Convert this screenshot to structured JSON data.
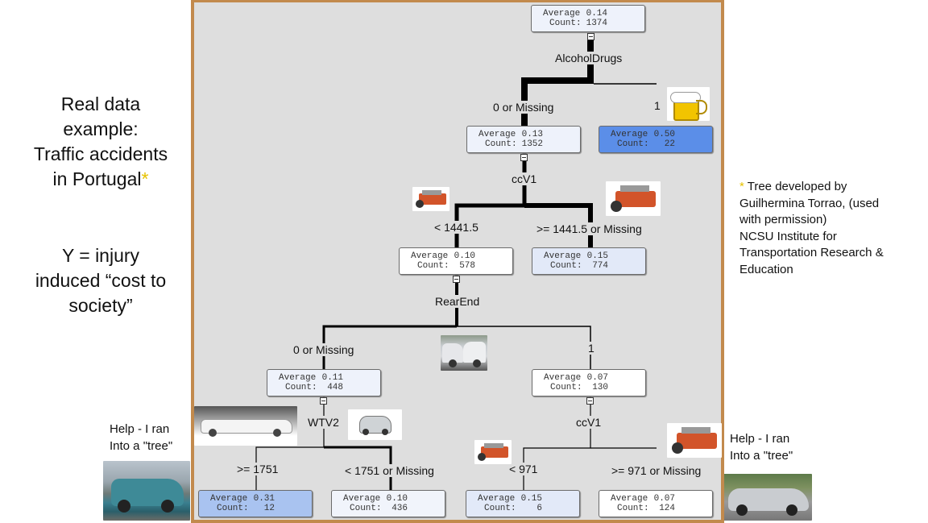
{
  "left_panel": {
    "title_lines": [
      "Real data",
      "example:",
      "Traffic accidents",
      "in Portugal"
    ],
    "title_marker": "*",
    "y_lines": [
      "Y = injury",
      "induced “cost to",
      "society”"
    ]
  },
  "credit": {
    "marker": "*",
    "lines": [
      " Tree developed by",
      "Guilhermina Torrao, (used",
      "with permission)",
      "NCSU  Institute for",
      "Transportation Research &",
      "Education"
    ]
  },
  "help_left": {
    "lines": [
      "Help - I ran",
      "Into  a \"tree\""
    ],
    "image": "wrecked-teal-car-photo"
  },
  "help_right": {
    "lines": [
      "Help - I ran",
      "Into  a \"tree\""
    ],
    "image": "wrecked-silver-car-photo"
  },
  "tree": {
    "colors": {
      "frame": "#c28a4d",
      "background": "#dedede",
      "light_node": "#eef2fb",
      "white_node": "#ffffff",
      "mid_node": "#c9d8f5",
      "strong_node": "#5b8ee8",
      "node_031": "#a9c3f0"
    },
    "node_labels": {
      "avg": "Average",
      "count": "Count:"
    },
    "nodes": [
      {
        "id": "root",
        "average": "0.14",
        "count": "1374"
      },
      {
        "id": "alc-0",
        "average": "0.13",
        "count": "1352"
      },
      {
        "id": "alc-1",
        "average": "0.50",
        "count": "22"
      },
      {
        "id": "cc-lt",
        "average": "0.10",
        "count": "578"
      },
      {
        "id": "cc-ge",
        "average": "0.15",
        "count": "774"
      },
      {
        "id": "rear-0",
        "average": "0.11",
        "count": "448"
      },
      {
        "id": "rear-1",
        "average": "0.07",
        "count": "130"
      },
      {
        "id": "wtv-ge",
        "average": "0.31",
        "count": "12"
      },
      {
        "id": "wtv-lt",
        "average": "0.10",
        "count": "436"
      },
      {
        "id": "cc2-lt",
        "average": "0.15",
        "count": "6"
      },
      {
        "id": "cc2-ge",
        "average": "0.07",
        "count": "124"
      }
    ],
    "split_vars": [
      "AlcoholDrugs",
      "ccV1",
      "RearEnd",
      "WTV2",
      "ccV1"
    ],
    "branch_labels": [
      "0 or Missing",
      "1",
      "< 1441.5",
      ">= 1441.5 or Missing",
      "0 or Missing",
      "1",
      ">= 1751",
      "< 1751 or Missing",
      "< 971",
      ">= 971 or Missing"
    ],
    "images": [
      "beer-mug",
      "engine-small",
      "engine-large",
      "crashed-cars",
      "limousine",
      "smart-car",
      "engine-small-2",
      "engine-large-2"
    ]
  }
}
